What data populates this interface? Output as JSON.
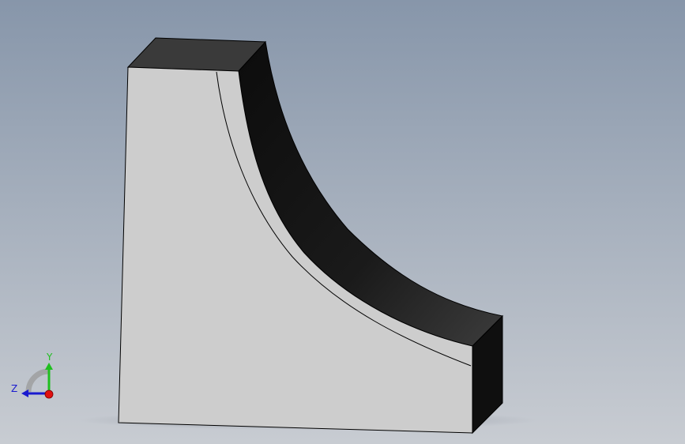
{
  "viewport": {
    "background_top": "#8796aa",
    "background_bottom": "#c8ccd2"
  },
  "part": {
    "front_face_color": "#cdcdcd",
    "top_face_color": "#3a3a3a",
    "curved_face_color": "#141414",
    "end_face_color": "#0f0f0f",
    "edge_color": "#000000"
  },
  "triad": {
    "y_label": "Y",
    "z_label": "Z",
    "y_color": "#1fbf1f",
    "z_color": "#1a1acf",
    "x_color": "#e01010"
  }
}
